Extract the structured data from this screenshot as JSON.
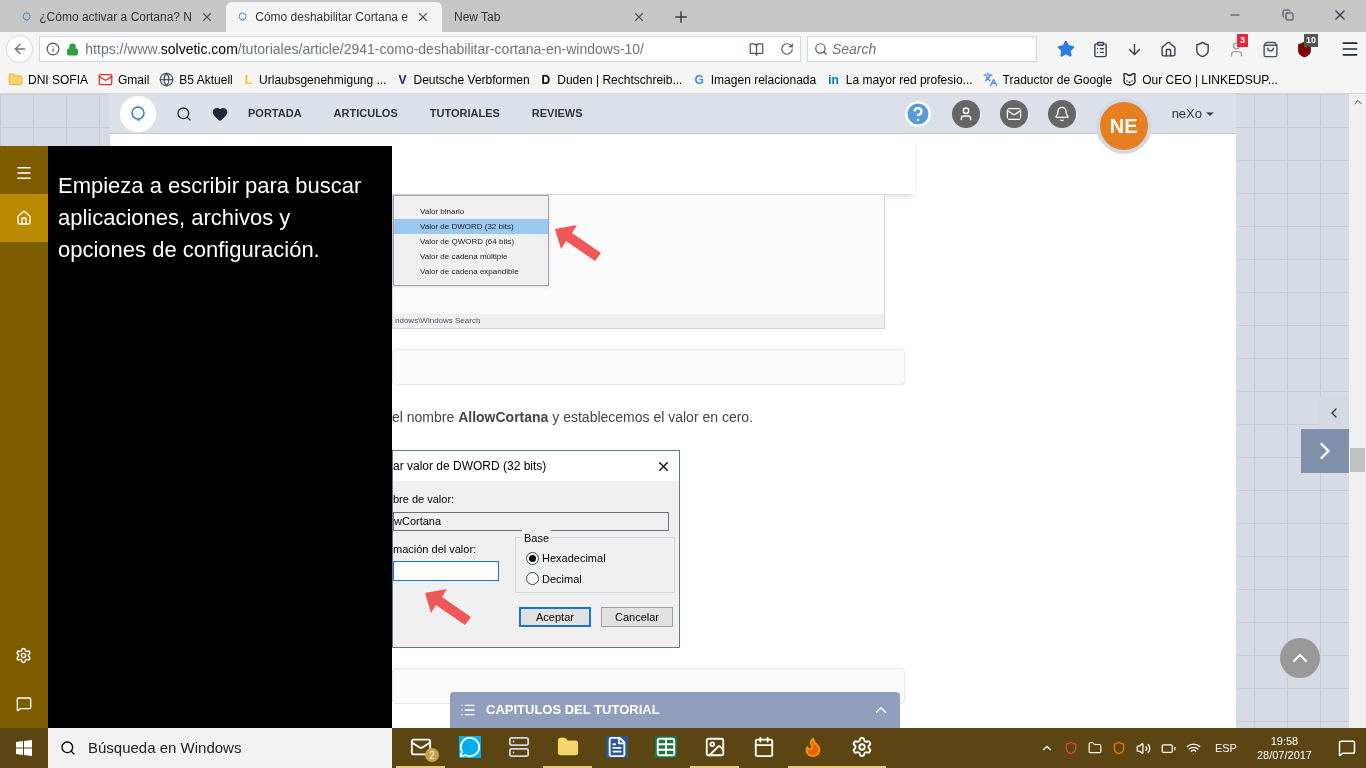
{
  "browser": {
    "tabs": [
      {
        "title": "¿Cómo activar a Cortana? N",
        "selected": false
      },
      {
        "title": "Cómo deshabilitar Cortana e",
        "selected": true
      },
      {
        "title": "New Tab",
        "selected": false
      }
    ],
    "url": {
      "host": "https://www.",
      "domain": "solvetic.com",
      "path": "/tutoriales/article/2941-como-deshabilitar-cortana-en-windows-10/"
    },
    "search_placeholder": "Search",
    "addon_badges": [
      "3",
      "10"
    ],
    "bookmarks": [
      {
        "kind": "folder",
        "label": "DNI SOFIA"
      },
      {
        "kind": "gmail",
        "label": "Gmail"
      },
      {
        "kind": "globe",
        "label": "B5 Aktuell"
      },
      {
        "kind": "letter",
        "logo": "L",
        "color": "#f5c518",
        "label": "Urlaubsgenehmigung ..."
      },
      {
        "kind": "letter",
        "logo": "V",
        "color": "#1a237e",
        "label": "Deutsche Verbformen"
      },
      {
        "kind": "letter",
        "logo": "D",
        "color": "#000000",
        "label": "Duden | Rechtschreib..."
      },
      {
        "kind": "letter",
        "logo": "G",
        "color": "#4285f4",
        "label": "Imagen relacionada"
      },
      {
        "kind": "letter",
        "logo": "in",
        "color": "#0077b5",
        "label": "La mayor red profesio..."
      },
      {
        "kind": "translate",
        "label": "Traductor de Google"
      },
      {
        "kind": "cat",
        "label": "Our CEO | LINKEDSUP..."
      }
    ]
  },
  "site": {
    "nav": [
      "PORTADA",
      "ARTICULOS",
      "TUTORIALES",
      "REVIEWS"
    ],
    "avatar": "NE",
    "user": "neXo"
  },
  "article": {
    "registry_menu": [
      {
        "label": "Valor binario",
        "selected": false
      },
      {
        "label": "Valor de DWORD (32 bits)",
        "selected": true
      },
      {
        "label": "Valor de QWORD (64 bits)",
        "selected": false
      },
      {
        "label": "Valor de cadena múltiple",
        "selected": false
      },
      {
        "label": "Valor de cadena expandible",
        "selected": false
      }
    ],
    "registry_path": "ndows\\Windows Search",
    "sentence": "el nombre **AllowCortana** y establecemos el valor en cero.",
    "dialog": {
      "title": "ar valor de DWORD (32 bits)",
      "name_label": "bre de valor:",
      "name_value": "wCortana",
      "data_label": "mación del valor:",
      "base_label": "Base",
      "radios": [
        {
          "label": "Hexadecimal",
          "selected": true
        },
        {
          "label": "Decimal",
          "selected": false
        }
      ],
      "buttons": [
        "Aceptar",
        "Cancelar"
      ]
    }
  },
  "chapters": "CAPITULOS DEL TUTORIAL",
  "cortana": {
    "prompt": "Empieza a escribir para buscar aplicaciones, archivos y opciones de configuración."
  },
  "taskbar": {
    "search": "Búsqueda en Windows",
    "apps": [
      {
        "kind": "mail",
        "badge": "2",
        "running": true
      },
      {
        "kind": "skype",
        "running": false
      },
      {
        "kind": "server",
        "running": false
      },
      {
        "kind": "folder",
        "running": true
      },
      {
        "kind": "word",
        "running": false
      },
      {
        "kind": "excel",
        "running": false
      },
      {
        "kind": "photos",
        "running": true
      },
      {
        "kind": "calendar",
        "running": false
      },
      {
        "kind": "firefox",
        "running": true
      },
      {
        "kind": "settings",
        "running": true
      }
    ],
    "language": "ESP",
    "time": "19:58",
    "date": "28/07/2017"
  }
}
